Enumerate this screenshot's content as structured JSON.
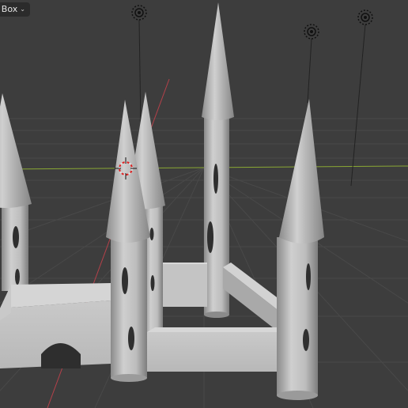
{
  "header": {
    "select_mode_label": "t Box",
    "dropdown_icon": "chevron-down-icon"
  },
  "scene": {
    "description_icons": [
      "light-icon",
      "light-icon",
      "light-icon",
      "3d-cursor-icon"
    ],
    "colors": {
      "background": "#3d3d3d",
      "grid": "#4a4a4a",
      "x_axis": "#b4414a",
      "y_axis": "#8aa834",
      "mesh_light": "#c8c8c8",
      "mesh_mid": "#a9a9a9",
      "mesh_dark": "#7a7a7a"
    }
  }
}
